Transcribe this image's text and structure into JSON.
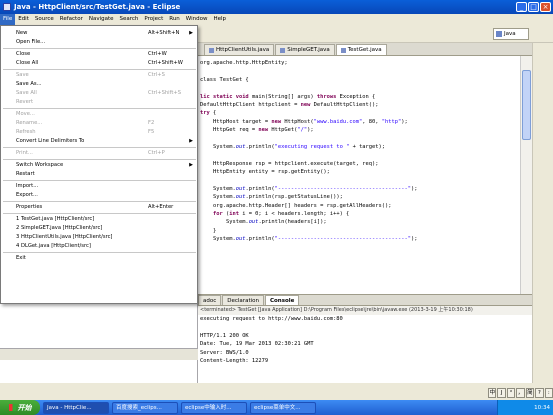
{
  "window": {
    "title": "Java - HttpClient/src/TestGet.java - Eclipse"
  },
  "menubar": [
    "File",
    "Edit",
    "Source",
    "Refactor",
    "Navigate",
    "Search",
    "Project",
    "Run",
    "Window",
    "Help"
  ],
  "perspective": {
    "label": "Java"
  },
  "file_menu": [
    {
      "label": "New",
      "accel": "Alt+Shift+N",
      "submenu": true
    },
    {
      "label": "Open File..."
    },
    {
      "sep": true
    },
    {
      "label": "Close",
      "accel": "Ctrl+W"
    },
    {
      "label": "Close All",
      "accel": "Ctrl+Shift+W"
    },
    {
      "sep": true
    },
    {
      "label": "Save",
      "accel": "Ctrl+S",
      "disabled": true
    },
    {
      "label": "Save As..."
    },
    {
      "label": "Save All",
      "accel": "Ctrl+Shift+S",
      "disabled": true
    },
    {
      "label": "Revert",
      "disabled": true
    },
    {
      "sep": true
    },
    {
      "label": "Move...",
      "disabled": true
    },
    {
      "label": "Rename...",
      "accel": "F2",
      "disabled": true
    },
    {
      "label": "Refresh",
      "accel": "F5",
      "disabled": true
    },
    {
      "label": "Convert Line Delimiters To",
      "submenu": true
    },
    {
      "sep": true
    },
    {
      "label": "Print...",
      "accel": "Ctrl+P",
      "disabled": true
    },
    {
      "sep": true
    },
    {
      "label": "Switch Workspace",
      "submenu": true
    },
    {
      "label": "Restart"
    },
    {
      "sep": true
    },
    {
      "label": "Import..."
    },
    {
      "label": "Export..."
    },
    {
      "sep": true
    },
    {
      "label": "Properties",
      "accel": "Alt+Enter"
    },
    {
      "sep": true
    },
    {
      "label": "1 TestGet.java  [HttpClient/src]"
    },
    {
      "label": "2 SimpleGET.java  [HttpClient/src]"
    },
    {
      "label": "3 HttpClientUtils.java  [HttpClient/src]"
    },
    {
      "label": "4 DLGet.java  [HttpClient/src]"
    },
    {
      "sep": true
    },
    {
      "label": "Exit"
    }
  ],
  "editor_tabs": [
    {
      "label": "HttpClientUtils.java",
      "active": false
    },
    {
      "label": "SimpleGET.java",
      "active": false
    },
    {
      "label": "TestGet.java",
      "active": true
    }
  ],
  "code_lines": [
    [
      [
        "n",
        "org.apache.http.HttpEntity;"
      ]
    ],
    [
      [
        "n",
        ""
      ]
    ],
    [
      [
        "n",
        "class TestGet {"
      ]
    ],
    [
      [
        "n",
        ""
      ]
    ],
    [
      [
        "k",
        "lic static void "
      ],
      [
        "n",
        "main(String[] args) "
      ],
      [
        "k",
        "throws "
      ],
      [
        "n",
        "Exception {"
      ]
    ],
    [
      [
        "n",
        "DefaultHttpClient httpclient = "
      ],
      [
        "k",
        "new "
      ],
      [
        "n",
        "DefaultHttpClient();"
      ]
    ],
    [
      [
        "k",
        "try "
      ],
      [
        "n",
        "{"
      ]
    ],
    [
      [
        "n",
        "    HttpHost target = "
      ],
      [
        "k",
        "new "
      ],
      [
        "n",
        "HttpHost("
      ],
      [
        "s",
        "\"www.baidu.com\""
      ],
      [
        "n",
        ", 80, "
      ],
      [
        "s",
        "\"http\""
      ],
      [
        "n",
        ");"
      ]
    ],
    [
      [
        "n",
        "    HttpGet req = "
      ],
      [
        "k",
        "new "
      ],
      [
        "n",
        "HttpGet("
      ],
      [
        "s",
        "\"/\""
      ],
      [
        "n",
        ");"
      ]
    ],
    [
      [
        "n",
        ""
      ]
    ],
    [
      [
        "n",
        "    System."
      ],
      [
        "f",
        "out"
      ],
      [
        "n",
        ".println("
      ],
      [
        "s",
        "\"executing request to \""
      ],
      [
        "n",
        " + target);"
      ]
    ],
    [
      [
        "n",
        ""
      ]
    ],
    [
      [
        "n",
        "    HttpResponse rsp = httpclient.execute(target, req);"
      ]
    ],
    [
      [
        "n",
        "    HttpEntity entity = rsp.getEntity();"
      ]
    ],
    [
      [
        "n",
        ""
      ]
    ],
    [
      [
        "n",
        "    System."
      ],
      [
        "f",
        "out"
      ],
      [
        "n",
        ".println("
      ],
      [
        "s",
        "\"----------------------------------------\""
      ],
      [
        "n",
        ");"
      ]
    ],
    [
      [
        "n",
        "    System."
      ],
      [
        "f",
        "out"
      ],
      [
        "n",
        ".println(rsp.getStatusLine());"
      ]
    ],
    [
      [
        "n",
        "    org.apache.http.Header[] headers = rsp.getAllHeaders();"
      ]
    ],
    [
      [
        "n",
        "    "
      ],
      [
        "k",
        "for "
      ],
      [
        "n",
        "("
      ],
      [
        "k",
        "int "
      ],
      [
        "n",
        "i = 0; i < headers.length; i++) {"
      ]
    ],
    [
      [
        "n",
        "        System."
      ],
      [
        "f",
        "out"
      ],
      [
        "n",
        ".println(headers[i]);"
      ]
    ],
    [
      [
        "n",
        "    }"
      ]
    ],
    [
      [
        "n",
        "    System."
      ],
      [
        "f",
        "out"
      ],
      [
        "n",
        ".println("
      ],
      [
        "s",
        "\"----------------------------------------\""
      ],
      [
        "n",
        ");"
      ]
    ]
  ],
  "bottom_tabs": [
    {
      "label": "adoc",
      "active": false
    },
    {
      "label": "Declaration",
      "active": false
    },
    {
      "label": "Console",
      "active": true
    }
  ],
  "console": {
    "terminated": "<terminated> TestGet [Java Application] D:\\Program Files\\eclipse\\jre\\bin\\javaw.exe (2013-3-19 上午10:30:18)",
    "lines": [
      "executing request to http://www.baidu.com:80",
      "",
      "HTTP/1.1 200 OK",
      "Date: Tue, 19 Mar 2013 02:30:21 GMT",
      "Server: BWS/1.0",
      "Content-Length: 12279"
    ]
  },
  "taskbar": {
    "start": "开始",
    "buttons": [
      {
        "label": "Java - HttpClie...",
        "active": true
      },
      {
        "label": "百度搜索_eclips...",
        "active": false
      },
      {
        "label": "eclipse中输入时...",
        "active": false
      },
      {
        "label": "eclipse菜单中文...",
        "active": false
      }
    ],
    "clock": "10:34"
  },
  "ime": [
    "中",
    "J",
    "°",
    "，",
    "简",
    "?",
    ":"
  ]
}
